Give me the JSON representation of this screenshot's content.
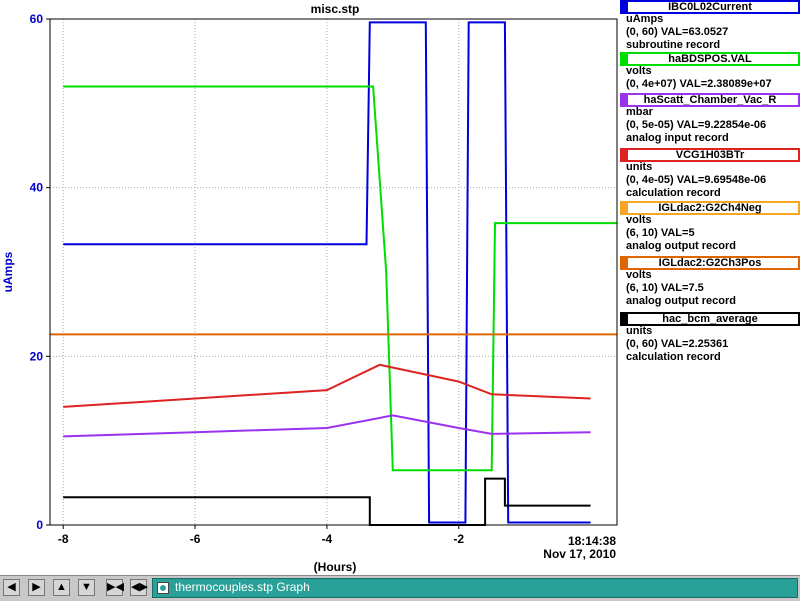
{
  "chart_data": {
    "type": "line",
    "title": "misc.stp",
    "xlabel": "(Hours)",
    "ylabel": "uAmps",
    "xlim": [
      -8.2,
      0.4
    ],
    "ylim": [
      0,
      60
    ],
    "x_ticks": [
      -8,
      -6,
      -4,
      -2
    ],
    "x_tick_labels": [
      "-8",
      "-6",
      "-4",
      "-2"
    ],
    "y_ticks": [
      0,
      20,
      40,
      60
    ],
    "y_tick_labels": [
      "0",
      "20",
      "40",
      "60"
    ],
    "end_time": "18:14:38",
    "end_date": "Nov 17, 2010",
    "grid": true,
    "axis_color": "#0000cc",
    "series": [
      {
        "color": "#0000dd",
        "x": [
          -8.0,
          -3.4,
          -3.35,
          -2.5,
          -2.45,
          -1.9,
          -1.85,
          -1.3,
          -1.25,
          0.0
        ],
        "y": [
          33.3,
          33.3,
          59.6,
          59.6,
          0.3,
          0.3,
          59.6,
          59.6,
          0.3,
          0.3
        ]
      },
      {
        "color": "#00dd00",
        "x": [
          -8.0,
          -3.3,
          -3.1,
          -3.0,
          -1.5,
          -1.45,
          0.4
        ],
        "y": [
          52.0,
          52.0,
          30.0,
          6.5,
          6.5,
          35.8,
          35.8
        ]
      },
      {
        "color": "#9933ee",
        "x": [
          -8.0,
          -6.0,
          -4.0,
          -3.0,
          -2.0,
          -1.5,
          0.0
        ],
        "y": [
          10.5,
          11.0,
          11.5,
          13.0,
          11.5,
          10.8,
          11.0
        ]
      },
      {
        "color": "#dd2222",
        "x": [
          -8.0,
          -6.0,
          -4.0,
          -3.2,
          -2.0,
          -1.5,
          0.0
        ],
        "y": [
          14.0,
          15.0,
          16.0,
          19.0,
          17.0,
          15.5,
          15.0
        ]
      },
      {
        "color": "#dd6600",
        "x": [
          -8.2,
          0.4
        ],
        "y": [
          22.6,
          22.6
        ]
      },
      {
        "color": "#000000",
        "x": [
          -8.0,
          -3.35,
          -3.35,
          -1.6,
          -1.6,
          -1.3,
          -1.3,
          0.0
        ],
        "y": [
          3.3,
          3.3,
          0.0,
          0.0,
          5.5,
          5.5,
          2.3,
          2.3
        ]
      }
    ]
  },
  "legend": [
    {
      "name": "IBC0L02Current",
      "color": "#0000dd",
      "units": "uAmps",
      "range_val": "(0, 60) VAL=63.0527",
      "type": "subroutine record"
    },
    {
      "name": "haBDSPOS.VAL",
      "color": "#00dd00",
      "units": "volts",
      "range_val": "(0, 4e+07) VAL=2.38089e+07",
      "type": ""
    },
    {
      "name": "haScatt_Chamber_Vac_R",
      "color": "#9933ee",
      "units": "mbar",
      "range_val": "(0, 5e-05) VAL=9.22854e-06",
      "type": "analog input record"
    },
    {
      "name": "VCG1H03BTr",
      "color": "#dd2222",
      "units": "units",
      "range_val": "(0, 4e-05) VAL=9.69548e-06",
      "type": "calculation record"
    },
    {
      "name": "IGLdac2:G2Ch4Neg",
      "color": "#f5a623",
      "units": "volts",
      "range_val": "(6, 10) VAL=5",
      "type": "analog output record"
    },
    {
      "name": "IGLdac2:G2Ch3Pos",
      "color": "#dd6600",
      "units": "volts",
      "range_val": "(6, 10) VAL=7.5",
      "type": "analog output record"
    },
    {
      "name": "hac_bcm_average",
      "color": "#000000",
      "units": "units",
      "range_val": "(0, 60) VAL=2.25361",
      "type": "calculation record"
    }
  ],
  "taskbar": {
    "nav_icons": [
      "arrow-left-icon",
      "arrow-right-icon",
      "arrow-up-icon",
      "arrow-down-icon",
      "zoom-in-icon",
      "zoom-out-icon"
    ],
    "task_label": "thermocouples.stp Graph"
  }
}
